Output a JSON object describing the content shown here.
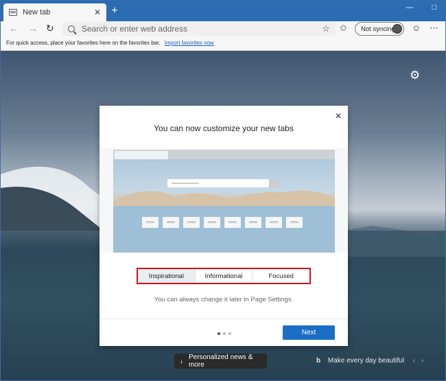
{
  "tab": {
    "title": "New tab",
    "close": "✕"
  },
  "newtab_button": "+",
  "window": {
    "minimize": "—",
    "maximize": "□"
  },
  "address_bar": {
    "placeholder": "Search or enter web address"
  },
  "sync": {
    "label": "Not syncing"
  },
  "favorites_bar": {
    "text": "For quick access, place your favorites here on the favorites bar.",
    "link": "Import favorites now"
  },
  "dialog": {
    "title": "You can now customize your new tabs",
    "close": "✕",
    "options": [
      {
        "label": "Inspirational",
        "selected": true
      },
      {
        "label": "Informational",
        "selected": false
      },
      {
        "label": "Focused",
        "selected": false
      }
    ],
    "hint": "You can always change it later in Page Settings.",
    "next_label": "Next",
    "pager": {
      "count": 3,
      "active": 1
    }
  },
  "bottom": {
    "news_label": "Personalized news & more",
    "caption": "Make every day beautiful"
  },
  "icons": {
    "back": "back-arrow-icon",
    "forward": "forward-arrow-icon",
    "refresh": "refresh-icon",
    "favorite": "star-icon",
    "collections": "star-list-icon",
    "feedback": "feedback-icon",
    "menu": "more-icon",
    "settings": "gear-icon"
  },
  "colors": {
    "accent": "#1a6fc4",
    "titlebar": "#2b6cb3",
    "highlight_border": "#d0111b"
  }
}
